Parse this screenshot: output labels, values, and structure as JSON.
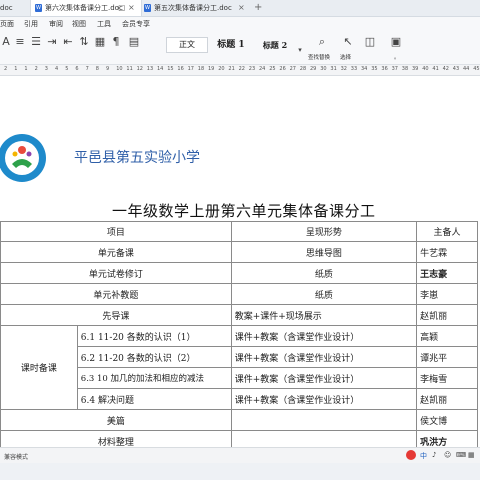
{
  "tabs": [
    {
      "label": "doc",
      "active": false
    },
    {
      "label": "第六次集体备课分工.doc",
      "active": true
    },
    {
      "label": "第五次集体备课分工.doc",
      "active": false
    }
  ],
  "menu": [
    "页面",
    "引用",
    "审阅",
    "视图",
    "工具",
    "会员专享"
  ],
  "ribbon": {
    "styles": [
      "正文",
      "标题 1",
      "标题 2"
    ],
    "find_label": "查找替换",
    "select_label": "选择",
    "labels_right": "。"
  },
  "ruler_numbers": [
    "2",
    "1",
    "1",
    "2",
    "3",
    "4",
    "5",
    "6",
    "7",
    "8",
    "9",
    "10",
    "11",
    "12",
    "13",
    "14",
    "15",
    "16",
    "17",
    "18",
    "19",
    "20",
    "21",
    "22",
    "23",
    "24",
    "25",
    "26",
    "27",
    "28",
    "29",
    "30",
    "31",
    "32",
    "33",
    "34",
    "35",
    "36",
    "37",
    "38",
    "39",
    "40",
    "41",
    "42",
    "43",
    "44",
    "45"
  ],
  "school_name": "平邑县第五实验小学",
  "document_title": "一年级数学上册第六单元集体备课分工",
  "table": {
    "headers": [
      "项目",
      "呈现形势",
      "主备人"
    ],
    "rows": [
      {
        "item": "单元备课",
        "form": "思维导图",
        "owner": "牛艺霖"
      },
      {
        "item": "单元试卷修订",
        "form": "纸质",
        "owner": "王志豪"
      },
      {
        "item": "单元补教题",
        "form": "纸质",
        "owner": "李崽"
      },
      {
        "item": "先导课",
        "form": "教案+课件+现场展示",
        "owner": "赵凯丽"
      }
    ],
    "group_label": "课时备课",
    "group_rows": [
      {
        "item": "6.1 11-20 各数的认识（1）",
        "form": "课件+教案（含课堂作业设计）",
        "owner": "高颖"
      },
      {
        "item": "6.2 11-20 各数的认识（2）",
        "form": "课件+教案（含课堂作业设计）",
        "owner": "谭兆平"
      },
      {
        "item": "6.3 10 加几的加法和相应的减法",
        "form": "课件+教案（含课堂作业设计）",
        "owner": "李梅雪"
      },
      {
        "item": "6.4 解决问题",
        "form": "课件+教案（含课堂作业设计）",
        "owner": "赵凯丽"
      }
    ],
    "tail_rows": [
      {
        "item": "美篇",
        "form": "",
        "owner": "侯文博"
      },
      {
        "item": "材料整理",
        "form": "",
        "owner": "巩洪方"
      }
    ]
  },
  "status": {
    "mode": "兼容模式"
  }
}
